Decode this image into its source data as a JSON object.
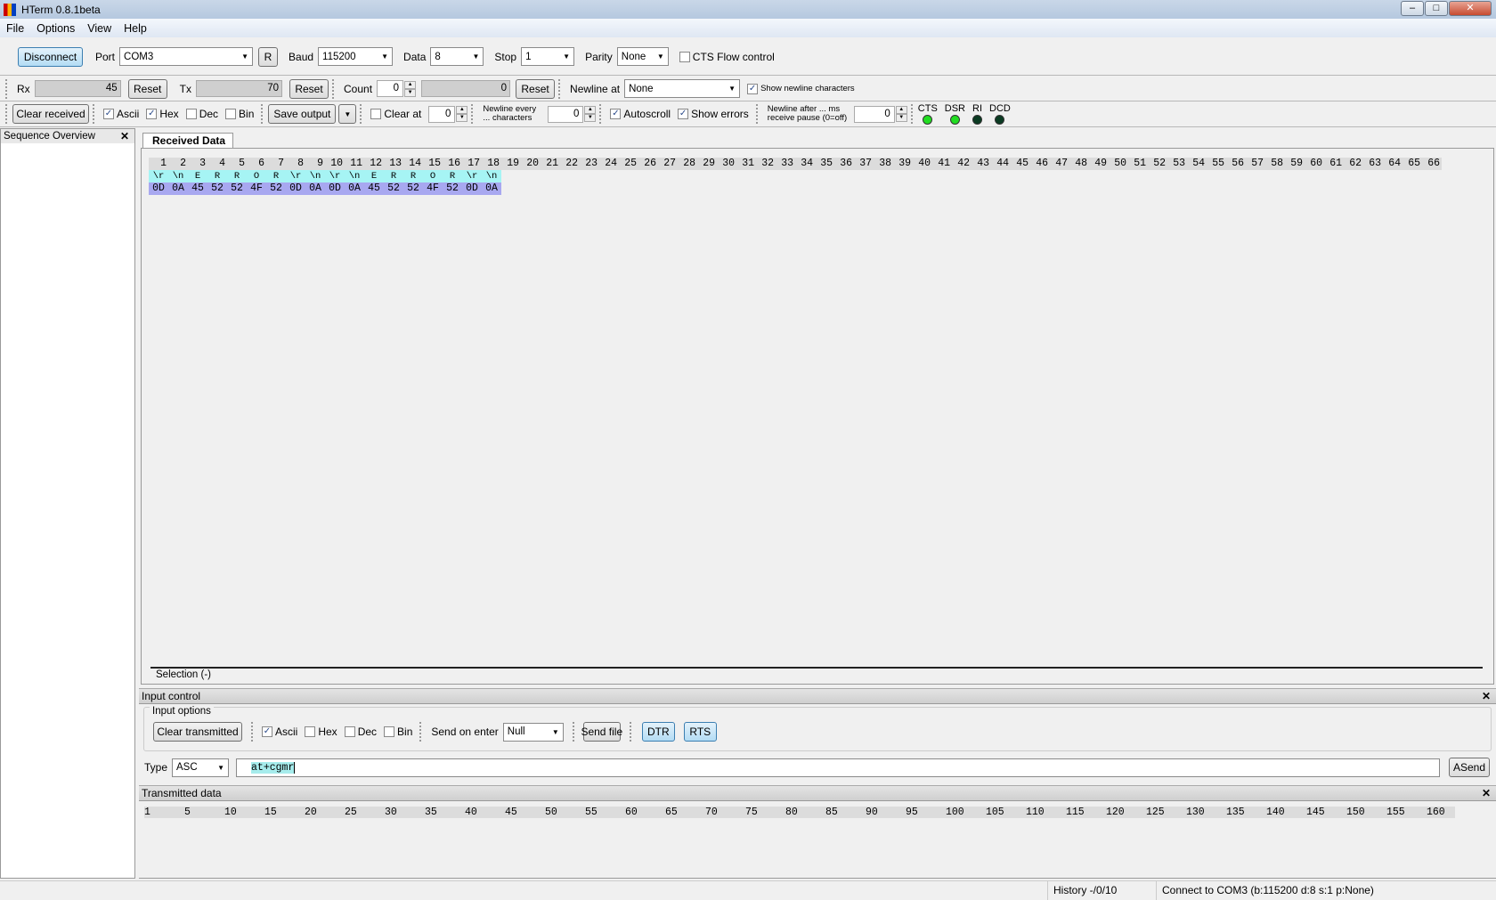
{
  "window": {
    "title": "HTerm 0.8.1beta",
    "min": "–",
    "max": "□",
    "close": "✕"
  },
  "menu": [
    "File",
    "Options",
    "View",
    "Help"
  ],
  "conn": {
    "disconnect": "Disconnect",
    "port_label": "Port",
    "port": "COM3",
    "refresh": "R",
    "baud_label": "Baud",
    "baud": "115200",
    "data_label": "Data",
    "data": "8",
    "stop_label": "Stop",
    "stop": "1",
    "parity_label": "Parity",
    "parity": "None",
    "cts_flow": "CTS Flow control"
  },
  "counters": {
    "rx_label": "Rx",
    "rx": "45",
    "reset": "Reset",
    "tx_label": "Tx",
    "tx": "70",
    "count_label": "Count",
    "count": "0",
    "count_value": "0",
    "newline_at_label": "Newline at",
    "newline_at": "None",
    "show_newline": "Show newline characters"
  },
  "view": {
    "clear_received": "Clear received",
    "ascii": "Ascii",
    "hex": "Hex",
    "dec": "Dec",
    "bin": "Bin",
    "save_output": "Save output",
    "clear_at": "Clear at",
    "clear_at_value": "0",
    "newline_every": "Newline every ... characters",
    "newline_every_value": "0",
    "autoscroll": "Autoscroll",
    "show_errors": "Show errors",
    "newline_after": "Newline after ... ms receive pause (0=off)",
    "newline_after_value": "0"
  },
  "signals": [
    {
      "label": "CTS",
      "color": "#22dd22"
    },
    {
      "label": "DSR",
      "color": "#22dd22"
    },
    {
      "label": "RI",
      "color": "#0b3b22"
    },
    {
      "label": "DCD",
      "color": "#0b3b22"
    }
  ],
  "sidebar": {
    "title": "Sequence Overview",
    "close": "✕"
  },
  "received": {
    "tab": "Received Data",
    "ruler_count": 66,
    "ascii": [
      "\\r",
      "\\n",
      "E",
      "R",
      "R",
      "O",
      "R",
      "\\r",
      "\\n",
      "\\r",
      "\\n",
      "E",
      "R",
      "R",
      "O",
      "R",
      "\\r",
      "\\n"
    ],
    "hex": [
      "0D",
      "0A",
      "45",
      "52",
      "52",
      "4F",
      "52",
      "0D",
      "0A",
      "0D",
      "0A",
      "45",
      "52",
      "52",
      "4F",
      "52",
      "0D",
      "0A"
    ],
    "selection": "Selection (-)"
  },
  "input": {
    "title": "Input control",
    "options_label": "Input options",
    "clear_transmitted": "Clear transmitted",
    "ascii": "Ascii",
    "hex": "Hex",
    "dec": "Dec",
    "bin": "Bin",
    "send_on_enter_label": "Send on enter",
    "send_on_enter": "Null",
    "send_file": "Send file",
    "dtr": "DTR",
    "rts": "RTS",
    "type_label": "Type",
    "type": "ASC",
    "text": "at+cgmr",
    "asend": "ASend",
    "close": "✕"
  },
  "transmitted": {
    "title": "Transmitted data",
    "ruler": [
      "1",
      "5",
      "10",
      "15",
      "20",
      "25",
      "30",
      "35",
      "40",
      "45",
      "50",
      "55",
      "60",
      "65",
      "70",
      "75",
      "80",
      "85",
      "90",
      "95",
      "100",
      "105",
      "110",
      "115",
      "120",
      "125",
      "130",
      "135",
      "140",
      "145",
      "150",
      "155",
      "160"
    ],
    "close": "✕"
  },
  "status": {
    "history": "History -/0/10",
    "connection": "Connect to COM3 (b:115200 d:8 s:1 p:None)"
  }
}
